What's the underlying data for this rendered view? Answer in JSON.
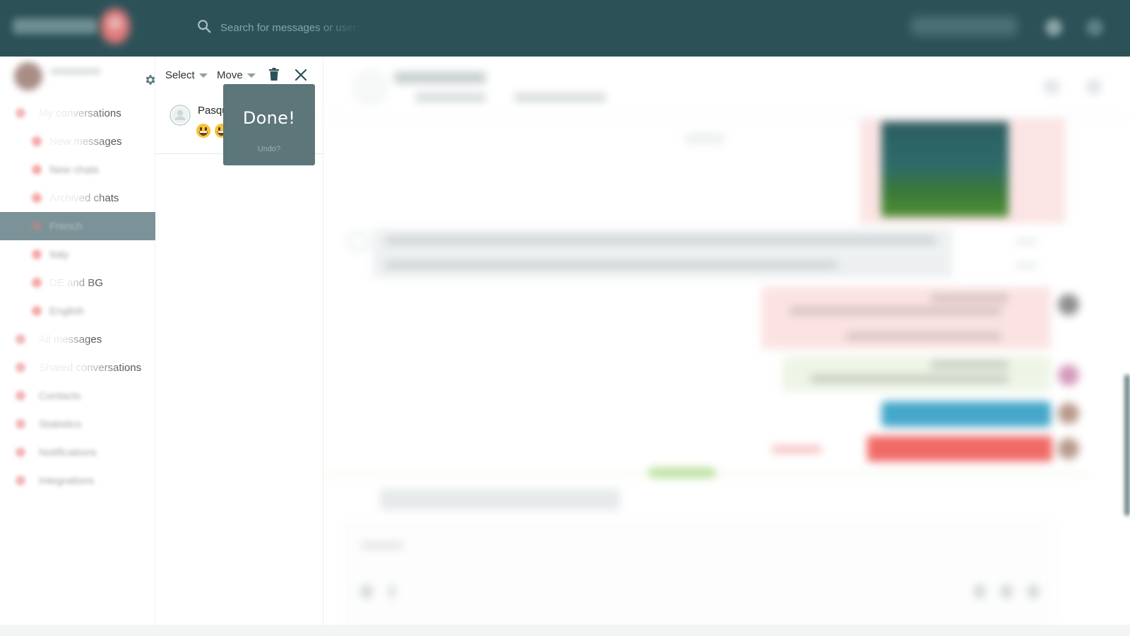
{
  "app": {
    "brand_colors": {
      "topbar": "#2c5258",
      "accent_active": "#7b9398",
      "toast_bg": "#5c7679"
    }
  },
  "header": {
    "search": {
      "placeholder": "Search for messages or users",
      "icon": "search-icon"
    },
    "icons": [
      "bell-icon",
      "apps-icon"
    ]
  },
  "sidebar": {
    "settings_icon": "gear-icon",
    "items": [
      {
        "label": "My conversations",
        "level": "top"
      },
      {
        "label": "New messages",
        "level": "sub"
      },
      {
        "label": "New chats",
        "level": "sub"
      },
      {
        "label": "Archived chats",
        "level": "sub"
      },
      {
        "label": "French",
        "level": "sub",
        "active": true
      },
      {
        "label": "Italy",
        "level": "sub"
      },
      {
        "label": "DE and BG",
        "level": "sub"
      },
      {
        "label": "English",
        "level": "sub"
      },
      {
        "label": "All messages",
        "level": "top"
      },
      {
        "label": "Shared conversations",
        "level": "top"
      },
      {
        "label": "Contacts",
        "level": "top"
      },
      {
        "label": "Statistics",
        "level": "top"
      },
      {
        "label": "Notifications",
        "level": "top"
      },
      {
        "label": "Integrations",
        "level": "top"
      }
    ]
  },
  "list_panel": {
    "toolbar": {
      "select_label": "Select",
      "move_label": "Move",
      "delete_icon": "trash-icon",
      "close_icon": "close-icon"
    },
    "conversations": [
      {
        "name": "Pasquale",
        "preview_emojis": [
          "grinning-face",
          "grinning-face"
        ]
      }
    ]
  },
  "toast": {
    "title": "Done!",
    "undo_label": "Undo?"
  },
  "chat": {
    "messages": [
      {
        "direction": "outgoing",
        "type": "image"
      },
      {
        "direction": "incoming",
        "lines": [
          "Please ...",
          "stat..."
        ]
      },
      {
        "direction": "outgoing",
        "type": "text",
        "style": "pink"
      },
      {
        "direction": "outgoing",
        "type": "text",
        "style": "green"
      },
      {
        "direction": "outgoing",
        "type": "text",
        "style": "blue"
      },
      {
        "direction": "outgoing",
        "type": "text",
        "style": "red"
      }
    ],
    "composer": {
      "placeholder": ""
    }
  }
}
